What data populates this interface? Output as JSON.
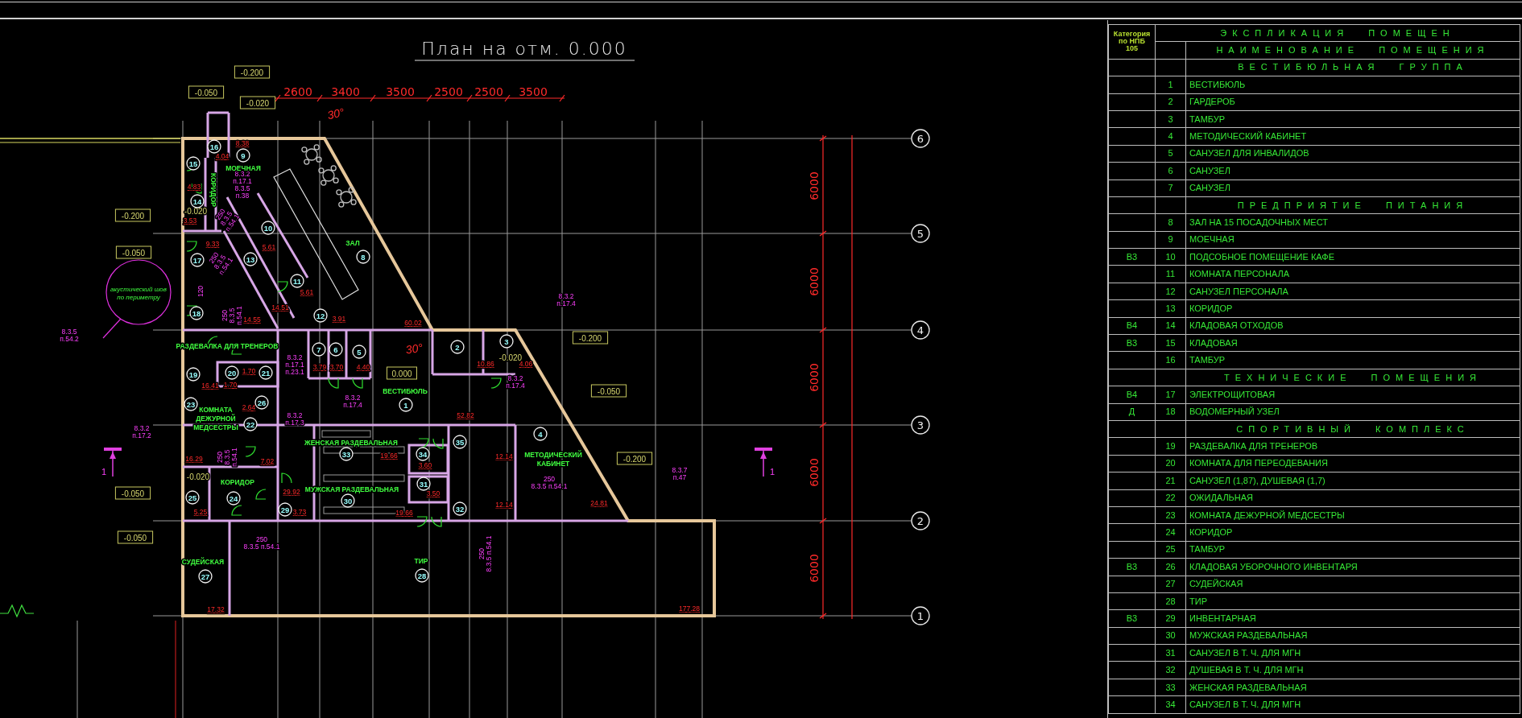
{
  "drawing": {
    "title": "План на отм. 0.000",
    "top_dimensions": [
      "2600",
      "3400",
      "3500",
      "2500",
      "2500",
      "3500"
    ],
    "side_dimensions": [
      "6000",
      "6000",
      "6000",
      "6000",
      "6000"
    ],
    "axes": [
      "6",
      "5",
      "4",
      "3",
      "2",
      "1"
    ],
    "angles": [
      "30°",
      "30°"
    ],
    "room_markers": [
      "16",
      "9",
      "15",
      "14",
      "10",
      "17",
      "13",
      "8",
      "11",
      "18",
      "12",
      "7",
      "6",
      "5",
      "2",
      "3",
      "19",
      "20",
      "21",
      "23",
      "26",
      "1",
      "22",
      "4",
      "35",
      "33",
      "34",
      "31",
      "25",
      "24",
      "30",
      "32",
      "29",
      "28",
      "27"
    ],
    "room_names": [
      [
        "МОЕЧНАЯ"
      ],
      [
        "КОРИДОР"
      ],
      [
        "ЗАЛ"
      ],
      [
        "РАЗДЕВАЛКА ДЛЯ ТРЕНЕРОВ"
      ],
      [
        "ВЕСТИБЮЛЬ"
      ],
      [
        "КОМНАТА",
        "ДЕЖУРНОЙ",
        "МЕДСЕСТРЫ"
      ],
      [
        "ЖЕНСКАЯ РАЗДЕВАЛЬНАЯ"
      ],
      [
        "МЕТОДИЧЕСКИЙ",
        "КАБИНЕТ"
      ],
      [
        "КОРИДОР"
      ],
      [
        "МУЖСКАЯ РАЗДЕВАЛЬНАЯ"
      ],
      [
        "ТИР"
      ],
      [
        "СУДЕЙСКАЯ"
      ]
    ],
    "note": [
      "акустический шов",
      "по периметру"
    ],
    "areas": [
      "8.38",
      "4.04",
      "4.83",
      "3.53",
      "9.33",
      "5.61",
      "5.61",
      "14.51",
      "14.55",
      "3.91",
      "60.02",
      "10.86",
      "4.06",
      "3.79",
      "3.70",
      "4.40",
      "1.70",
      "16.41",
      "1.70",
      "2.64",
      "52.82",
      "16.29",
      "7.02",
      "19.66",
      "3.60",
      "12.14",
      "29.92",
      "3.50",
      "12.14",
      "24.81",
      "5.25",
      "3.73",
      "19.66",
      "17.32",
      "177.28"
    ],
    "elevations": [
      {
        "kind": "boxed",
        "text": "-0.200"
      },
      {
        "kind": "boxed",
        "text": "-0.050"
      },
      {
        "kind": "boxed",
        "text": "-0.020"
      },
      {
        "kind": "boxed",
        "text": "-0.200"
      },
      {
        "kind": "boxed",
        "text": "-0.050"
      },
      {
        "kind": "boxed",
        "text": "0.000"
      },
      {
        "kind": "boxed",
        "text": "-0.050"
      },
      {
        "kind": "boxed",
        "text": "-0.200"
      },
      {
        "kind": "boxed",
        "text": "-0.050"
      },
      {
        "kind": "boxed",
        "text": "-0.200"
      },
      {
        "kind": "boxed",
        "text": "-0.050"
      },
      {
        "kind": "plain",
        "text": "-0.020"
      },
      {
        "kind": "plain",
        "text": "-0.020"
      },
      {
        "kind": "plain",
        "text": "-0.020"
      }
    ],
    "norm_references": [
      [
        "8.3.2",
        "п.17.1",
        "8.3.5",
        "п.38"
      ],
      [
        "250",
        "8.3.5",
        "п.54.1"
      ],
      [
        "250",
        "8.3.5",
        "п.54.1"
      ],
      [
        "120"
      ],
      [
        "250",
        "8.3.5",
        "п.54.1"
      ],
      [
        "8.3.5",
        "п.54.2"
      ],
      [
        "8.3.2",
        "п.17.1",
        "п.23.1"
      ],
      [
        "8.3.2",
        "п.17.3"
      ],
      [
        "8.3.2",
        "п.17.4"
      ],
      [
        "8.3.2",
        "п.17.2"
      ],
      [
        "250",
        "8.3.5",
        "п.54.1"
      ],
      [
        "8.3.2",
        "п.17.4"
      ],
      [
        "8.3.2",
        "п.17.4"
      ],
      [
        "250",
        "8.3.5 п.54.1"
      ],
      [
        "8.3.7",
        "п.47"
      ],
      [
        "250",
        "8.3.5 п.54.1"
      ],
      [
        "250",
        "8.3.5 п.54.1"
      ]
    ],
    "section_marks": [
      "1",
      "1"
    ]
  },
  "explication": {
    "category_header": "Категория по НПБ 105",
    "title": "ЭКСПЛИКАЦИЯ ПОМЕЩЕН",
    "name_header": "НАИМЕНОВАНИЕ ПОМЕЩЕНИЯ",
    "sections": [
      {
        "title": "ВЕСТИБЮЛЬНАЯ ГРУППА",
        "rooms": [
          {
            "number": "1",
            "name": "ВЕСТИБЮЛЬ"
          },
          {
            "number": "2",
            "name": "ГАРДЕРОБ"
          },
          {
            "number": "3",
            "name": "ТАМБУР"
          },
          {
            "number": "4",
            "name": "МЕТОДИЧЕСКИЙ КАБИНЕТ"
          },
          {
            "number": "5",
            "name": "САНУЗЕЛ ДЛЯ ИНВАЛИДОВ"
          },
          {
            "number": "6",
            "name": "САНУЗЕЛ"
          },
          {
            "number": "7",
            "name": "САНУЗЕЛ"
          }
        ]
      },
      {
        "title": "ПРЕДПРИЯТИЕ ПИТАНИЯ",
        "rooms": [
          {
            "number": "8",
            "name": "ЗАЛ НА 15 ПОСАДОЧНЫХ МЕСТ"
          },
          {
            "number": "9",
            "name": "МОЕЧНАЯ"
          },
          {
            "category": "В3",
            "number": "10",
            "name": "ПОДСОБНОЕ ПОМЕЩЕНИЕ КАФЕ"
          },
          {
            "number": "11",
            "name": "КОМНАТА ПЕРСОНАЛА"
          },
          {
            "number": "12",
            "name": "САНУЗЕЛ ПЕРСОНАЛА"
          },
          {
            "number": "13",
            "name": "КОРИДОР"
          },
          {
            "category": "В4",
            "number": "14",
            "name": "КЛАДОВАЯ ОТХОДОВ"
          },
          {
            "category": "В3",
            "number": "15",
            "name": "КЛАДОВАЯ"
          },
          {
            "number": "16",
            "name": "ТАМБУР"
          }
        ]
      },
      {
        "title": "ТЕХНИЧЕСКИЕ ПОМЕЩЕНИЯ",
        "rooms": [
          {
            "category": "В4",
            "number": "17",
            "name": "ЭЛЕКТРОЩИТОВАЯ"
          },
          {
            "category": "Д",
            "number": "18",
            "name": "ВОДОМЕРНЫЙ УЗЕЛ"
          }
        ]
      },
      {
        "title": "СПОРТИВНЫЙ КОМПЛЕКС",
        "rooms": [
          {
            "number": "19",
            "name": "РАЗДЕВАЛКА ДЛЯ ТРЕНЕРОВ"
          },
          {
            "number": "20",
            "name": "КОМНАТА ДЛЯ ПЕРЕОДЕВАНИЯ"
          },
          {
            "number": "21",
            "name": "САНУЗЕЛ (1,87), ДУШЕВАЯ (1,7)"
          },
          {
            "number": "22",
            "name": "ОЖИДАЛЬНАЯ"
          },
          {
            "number": "23",
            "name": "КОМНАТА ДЕЖУРНОЙ МЕДСЕСТРЫ"
          },
          {
            "number": "24",
            "name": "КОРИДОР"
          },
          {
            "number": "25",
            "name": "ТАМБУР"
          },
          {
            "category": "В3",
            "number": "26",
            "name": "КЛАДОВАЯ УБОРОЧНОГО ИНВЕНТАРЯ"
          },
          {
            "number": "27",
            "name": "СУДЕЙСКАЯ"
          },
          {
            "number": "28",
            "name": "ТИР"
          },
          {
            "category": "В3",
            "number": "29",
            "name": "ИНВЕНТАРНАЯ"
          },
          {
            "number": "30",
            "name": "МУЖСКАЯ РАЗДЕВАЛЬНАЯ"
          },
          {
            "number": "31",
            "name": "САНУЗЕЛ В Т. Ч. ДЛЯ МГН"
          },
          {
            "number": "32",
            "name": "ДУШЕВАЯ В Т. Ч. ДЛЯ МГН"
          },
          {
            "number": "33",
            "name": "ЖЕНСКАЯ РАЗДЕВАЛЬНАЯ"
          },
          {
            "number": "34",
            "name": "САНУЗЕЛ В Т. Ч. ДЛЯ МГН"
          }
        ]
      }
    ]
  }
}
